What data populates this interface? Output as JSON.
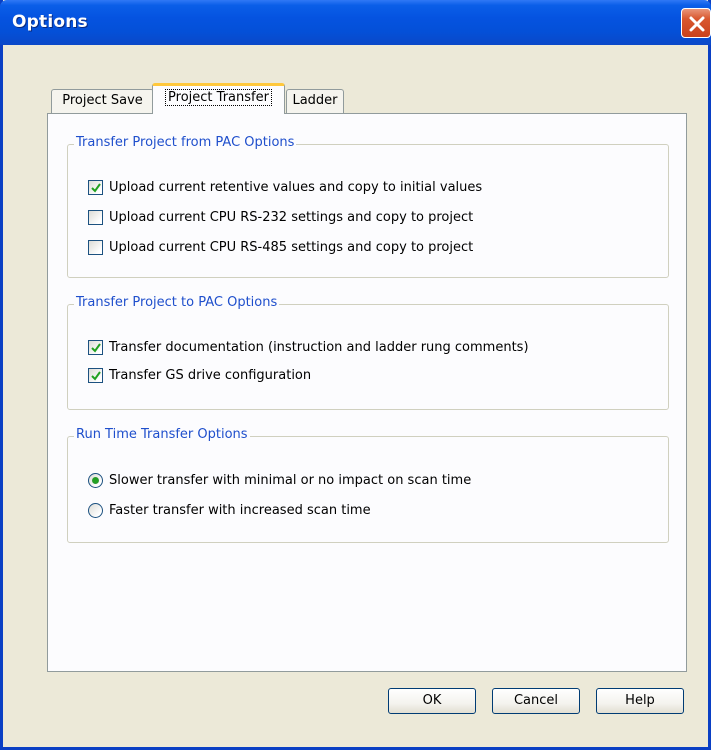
{
  "window": {
    "title": "Options"
  },
  "tabs": [
    {
      "label": "Project Save"
    },
    {
      "label": "Project Transfer"
    },
    {
      "label": "Ladder"
    }
  ],
  "active_tab": "Project Transfer",
  "groups": {
    "from_pac": {
      "title": "Transfer Project from PAC Options",
      "options": [
        {
          "label": "Upload current retentive values and copy to initial values",
          "checked": true
        },
        {
          "label": "Upload current CPU RS-232 settings and copy to project",
          "checked": false
        },
        {
          "label": "Upload current CPU RS-485 settings and copy to project",
          "checked": false
        }
      ]
    },
    "to_pac": {
      "title": "Transfer Project to PAC Options",
      "options": [
        {
          "label": "Transfer documentation (instruction and ladder rung comments)",
          "checked": true
        },
        {
          "label": "Transfer GS drive configuration",
          "checked": true
        }
      ]
    },
    "run_time": {
      "title": "Run Time Transfer Options",
      "options": [
        {
          "label": "Slower transfer with minimal or no impact on scan time",
          "selected": true
        },
        {
          "label": "Faster transfer with increased scan time",
          "selected": false
        }
      ]
    }
  },
  "buttons": {
    "ok": "OK",
    "cancel": "Cancel",
    "help": "Help"
  },
  "colors": {
    "titlebar": "#0553e0",
    "group_title": "#1f4fcc",
    "active_tab_accent": "#ffc83c"
  }
}
